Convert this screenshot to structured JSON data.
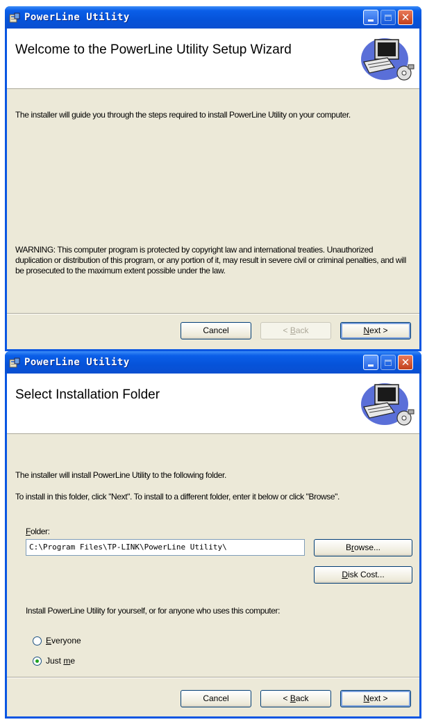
{
  "window1": {
    "title": "PowerLine Utility",
    "banner_title": "Welcome to the PowerLine Utility Setup Wizard",
    "intro": "The installer will guide you through the steps required to install PowerLine Utility on your computer.",
    "warning": "WARNING: This computer program is protected by copyright law and international treaties. Unauthorized duplication or distribution of this program, or any portion of it, may result in severe civil or criminal penalties, and will be prosecuted to the maximum extent possible under the law.",
    "buttons": {
      "cancel": "Cancel",
      "back_mn": "B",
      "back_rest": "ack",
      "back_prefix": "< ",
      "next_mn": "N",
      "next_rest": "ext >",
      "back_enabled": false
    }
  },
  "window2": {
    "title": "PowerLine Utility",
    "banner_title": "Select Installation Folder",
    "line1": "The installer will install PowerLine Utility to the following folder.",
    "line2": "To install in this folder, click \"Next\". To install to a different folder, enter it below or click \"Browse\".",
    "folder_label_mn": "F",
    "folder_label_rest": "older:",
    "folder_value": "C:\\Program Files\\TP-LINK\\PowerLine Utility\\",
    "browse_mn": "r",
    "browse_pre": "B",
    "browse_post": "owse...",
    "diskcost_mn": "D",
    "diskcost_rest": "isk Cost...",
    "install_for": "Install PowerLine Utility for yourself, or for anyone who uses this computer:",
    "radio_everyone_mn": "E",
    "radio_everyone_rest": "veryone",
    "radio_justme_pre": "Just ",
    "radio_justme_mn": "m",
    "radio_justme_rest": "e",
    "selected_option": "Just me",
    "buttons": {
      "cancel": "Cancel",
      "back_prefix": "< ",
      "back_mn": "B",
      "back_rest": "ack",
      "next_mn": "N",
      "next_rest": "ext >",
      "back_enabled": true
    }
  },
  "colors": {
    "titlebar": "#0a56e2",
    "client_bg": "#ece9d8",
    "button_border": "#003c74",
    "radio_dot": "#21a121"
  },
  "icons": [
    "app-icon",
    "minimize-icon",
    "maximize-icon",
    "close-icon",
    "computer-setup-icon"
  ]
}
